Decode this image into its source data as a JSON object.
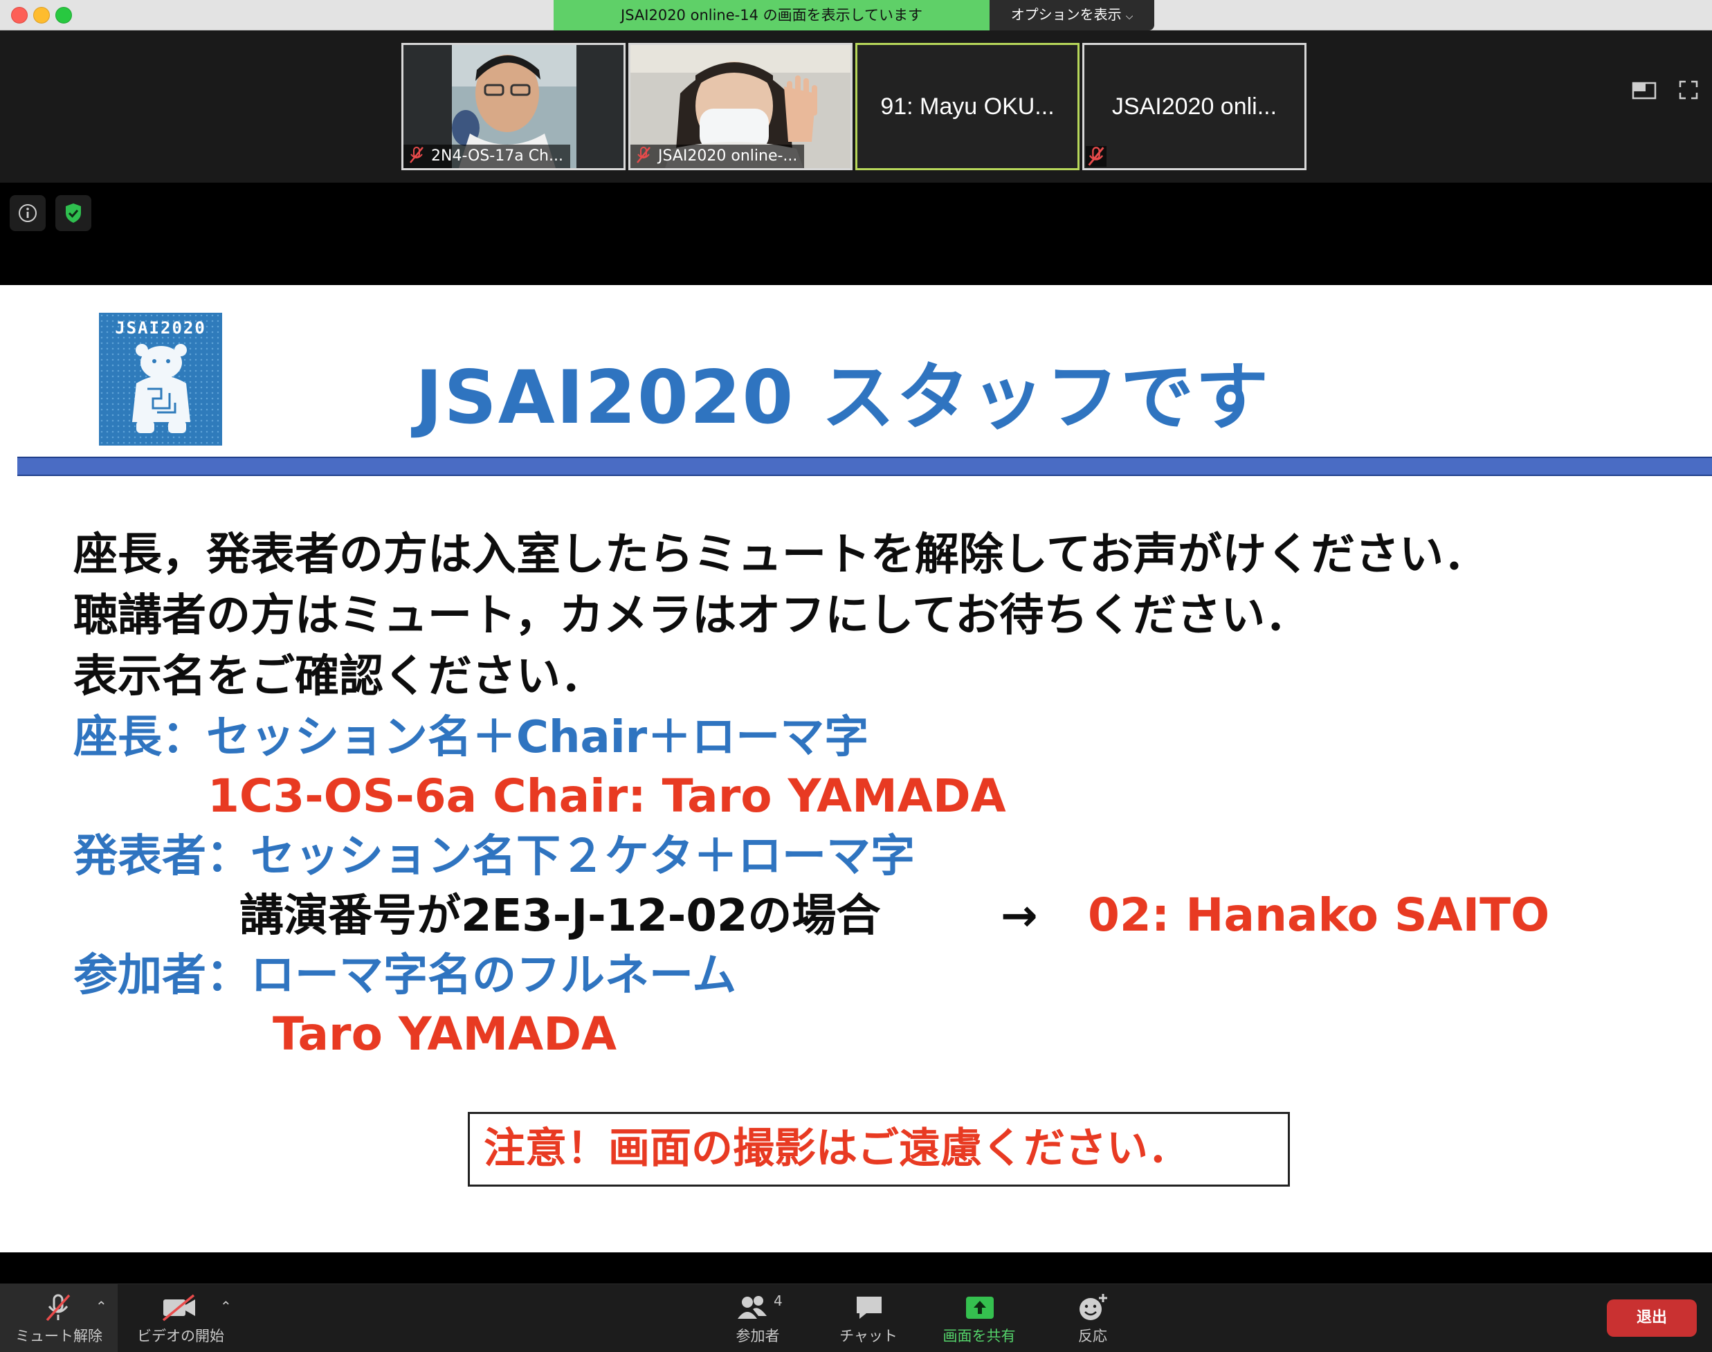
{
  "titlebar": {
    "share_banner": "JSAI2020 online-14 の画面を表示しています",
    "options_label": "オプションを表示"
  },
  "gallery": {
    "tiles": [
      {
        "name": "2N4-OS-17a Ch...",
        "muted": true
      },
      {
        "name": "JSAI2020 online-...",
        "muted": true
      },
      {
        "name": "91: Mayu OKU...",
        "muted": false,
        "active_speaker": true
      },
      {
        "name": "JSAI2020 onli...",
        "muted": true
      }
    ]
  },
  "slide": {
    "logo_text": "JSAI2020",
    "title": "JSAI2020 スタッフです",
    "lines": [
      "座長，発表者の方は入室したらミュートを解除してお声がけください．",
      "聴講者の方はミュート，カメラはオフにしてお待ちください．",
      "表示名をご確認ください．",
      "座長：セッション名＋Chair＋ローマ字",
      "1C3-OS-6a Chair: Taro YAMADA",
      "発表者：セッション名下２ケタ＋ローマ字",
      "講演番号が2E3-J-12-02の場合",
      "→",
      "02: Hanako SAITO",
      "参加者：ローマ字名のフルネーム",
      "Taro YAMADA"
    ],
    "notice": "注意！画面の撮影はご遠慮ください．"
  },
  "toolbar": {
    "unmute": "ミュート解除",
    "start_video": "ビデオの開始",
    "participants": "参加者",
    "participants_count": "4",
    "chat": "チャット",
    "share_screen": "画面を共有",
    "reactions": "反応",
    "leave": "退出"
  },
  "colors": {
    "share_green": "#5fd068",
    "slide_blue": "#2f74c0",
    "slide_red": "#e83a22",
    "rule_blue": "#4a6cc4",
    "leave_red": "#c93131"
  }
}
